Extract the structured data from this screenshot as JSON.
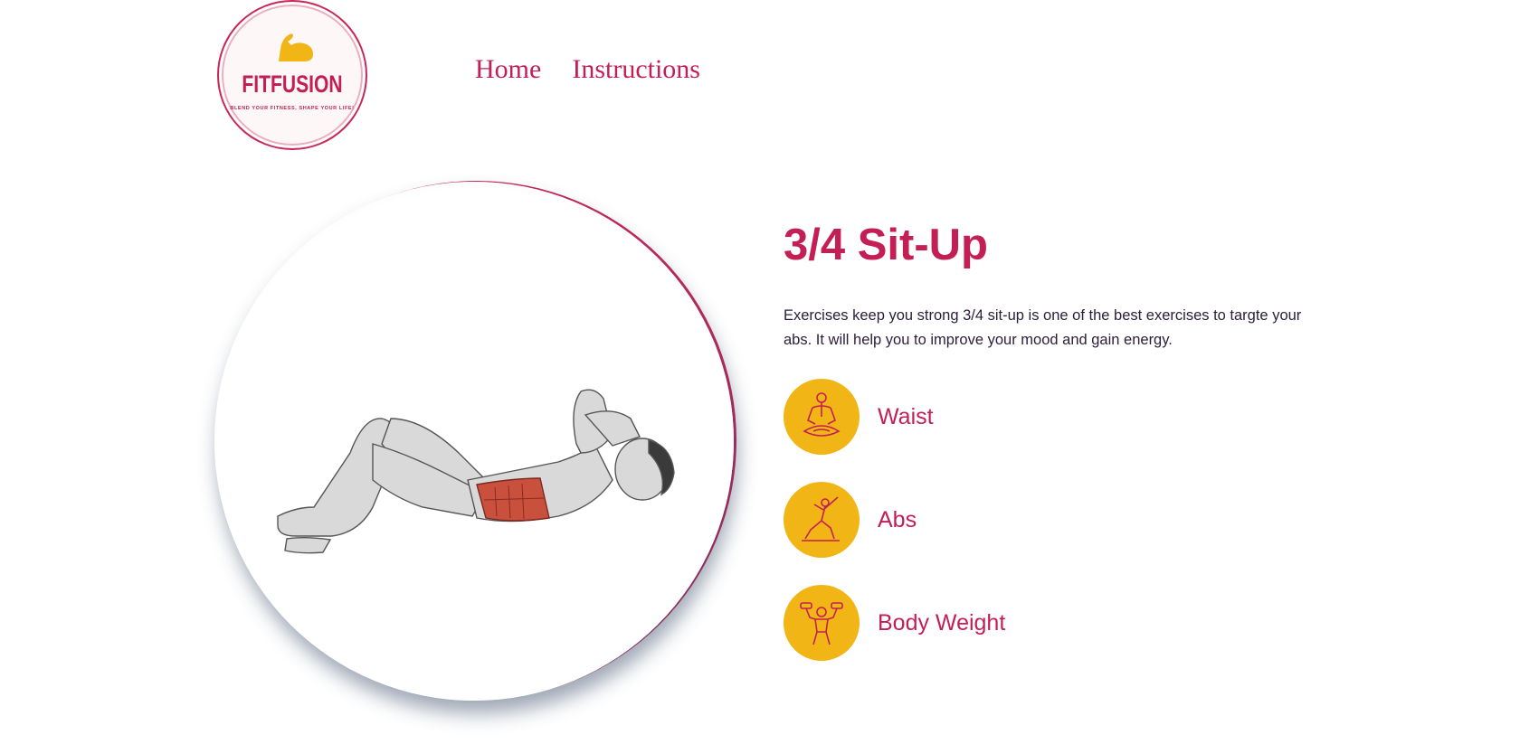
{
  "header": {
    "logo": {
      "brand": "FITFUSION",
      "tagline": "BLEND YOUR FITNESS, SHAPE YOUR LIFE!"
    },
    "nav": [
      {
        "label": "Home"
      },
      {
        "label": "Instructions"
      }
    ]
  },
  "exercise": {
    "title": "3/4 Sit-Up",
    "description": "Exercises keep you strong 3/4 sit-up is one of the best exercises to targte your abs. It will help you to improve your mood and gain energy.",
    "image_icon": "sit-up-muscle-illustration",
    "tags": [
      {
        "label": "Waist",
        "icon": "meditation-pose-icon"
      },
      {
        "label": "Abs",
        "icon": "lunge-pose-icon"
      },
      {
        "label": "Body Weight",
        "icon": "dumbbell-lifter-icon"
      }
    ]
  },
  "colors": {
    "accent": "#c41f55",
    "badge": "#f1b516",
    "text": "#2a1e3a",
    "background": "#ffffff"
  }
}
